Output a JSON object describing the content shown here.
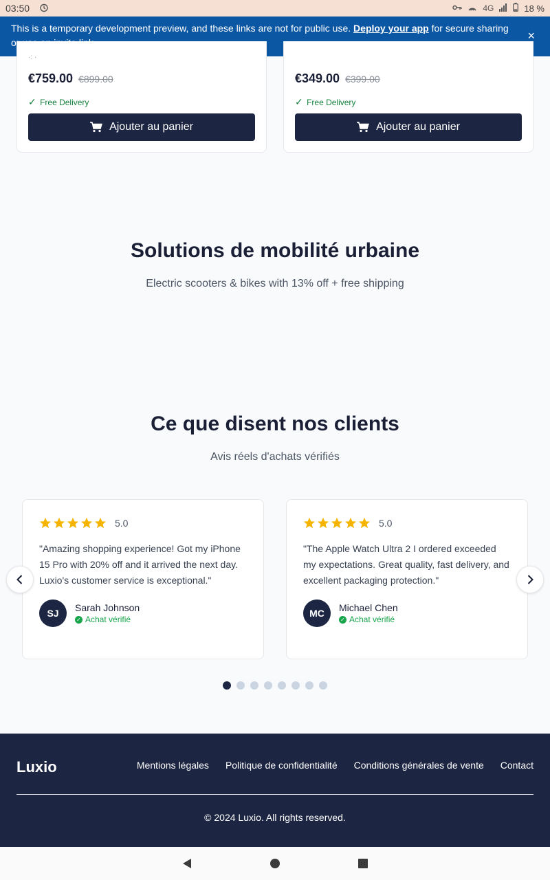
{
  "status_bar": {
    "time": "03:50",
    "network": "4G",
    "battery": "18 %"
  },
  "dev_banner": {
    "text_before": "This is a temporary development preview, and these links are not for public use. ",
    "link": "Deploy your app",
    "text_after": " for secure sharing or use an invite link.",
    "close": "×"
  },
  "products": [
    {
      "stub": "·: ·",
      "price": "€759.00",
      "old_price": "€899.00",
      "delivery_mark": "✓",
      "delivery": "Free Delivery",
      "button": "Ajouter au panier"
    },
    {
      "stub": "",
      "price": "€349.00",
      "old_price": "€399.00",
      "delivery_mark": "✓",
      "delivery": "Free Delivery",
      "button": "Ajouter au panier"
    }
  ],
  "mobility": {
    "title": "Solutions de mobilité urbaine",
    "subtitle": "Electric scooters & bikes with 13% off + free shipping"
  },
  "testimonials": {
    "title": "Ce que disent nos clients",
    "subtitle": "Avis réels d'achats vérifiés",
    "star_color": "#f5b400",
    "items": [
      {
        "rating": "5.0",
        "quote": "\"Amazing shopping experience! Got my iPhone 15 Pro with 20% off and it arrived the next day. Luxio's customer service is exceptional.\"",
        "initials": "SJ",
        "name": "Sarah Johnson",
        "verified": "Achat vérifié"
      },
      {
        "rating": "5.0",
        "quote": "\"The Apple Watch Ultra 2 I ordered exceeded my expectations. Great quality, fast delivery, and excellent packaging protection.\"",
        "initials": "MC",
        "name": "Michael Chen",
        "verified": "Achat vérifié"
      }
    ],
    "dots_count": 8,
    "active_dot": 0
  },
  "footer": {
    "brand": "Luxio",
    "links": [
      "Mentions légales",
      "Politique de confidentialité",
      "Conditions générales de vente",
      "Contact"
    ],
    "copyright": "© 2024 Luxio. All rights reserved."
  },
  "colors": {
    "primary": "#1c2541",
    "banner": "#0b57a4",
    "success": "#15803d"
  }
}
